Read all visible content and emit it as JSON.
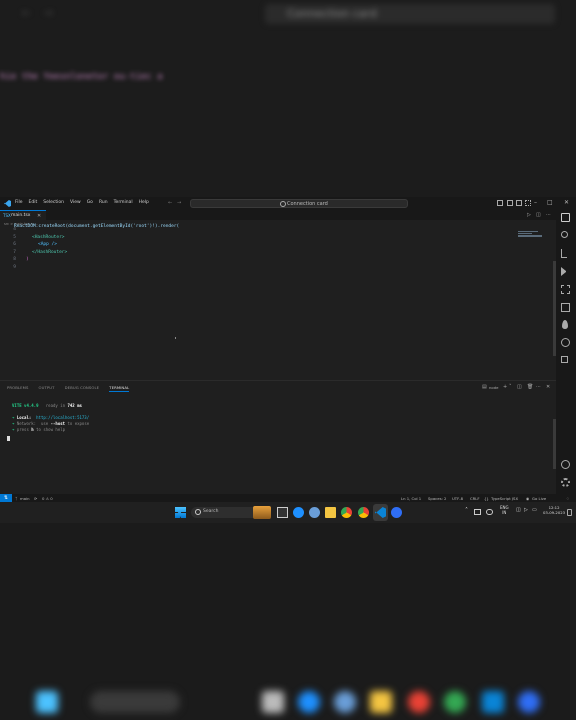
{
  "background": {
    "window_title": "Connection card",
    "code_line": "hie the Yeesnlonetor ou-tiec a"
  },
  "titlebar": {
    "menu": [
      "File",
      "Edit",
      "Selection",
      "View",
      "Go",
      "Run",
      "Terminal",
      "Help"
    ],
    "command_center": "Connection card"
  },
  "editor": {
    "tab_icon": "TSX",
    "tab_label": "main.tsx",
    "breadcrumb": "src > main.tsx > ...",
    "lines": [
      {
        "num": "4",
        "text": "ReactDOM.createRoot(document.getElementById('root')!).render("
      },
      {
        "num": "5",
        "text": "<HashRouter>"
      },
      {
        "num": "6",
        "text": "<App />"
      },
      {
        "num": "7",
        "text": "</HashRouter>"
      },
      {
        "num": "8",
        "text": ")"
      },
      {
        "num": "9",
        "text": ""
      }
    ]
  },
  "panel": {
    "tabs": [
      "PROBLEMS",
      "OUTPUT",
      "DEBUG CONSOLE",
      "TERMINAL"
    ],
    "terminal_label": "node",
    "terminal": {
      "vite": "VITE v4.4.9",
      "ready": "ready in",
      "ready_ms": "742 ms",
      "local_label": "Local:",
      "local_url": "http://localhost:5173/",
      "network_label": "Network:",
      "network_hint_pre": "use",
      "network_hint_flag": "--host",
      "network_hint_post": "to expose",
      "help_pre": "press",
      "help_key": "h",
      "help_post": "to show help"
    }
  },
  "statusbar": {
    "branch": "main",
    "problems": "0 ⚠ 0",
    "cursor": "Ln 1, Col 1",
    "spaces": "Spaces: 2",
    "encoding": "UTF-8",
    "eol": "CRLF",
    "language": "TypeScript JSX",
    "golive": "Go Live"
  },
  "taskbar": {
    "search_label": "Search",
    "lang_top": "ENG",
    "lang_bottom": "IN",
    "time": "12:12",
    "date": "03-09-2023"
  },
  "colors": {
    "accent": "#0078d4",
    "editor_bg": "#1f1f1f",
    "tag": "#4ec9b0",
    "component": "#4fc1ff",
    "terminal_green": "#23d18b",
    "terminal_cyan": "#29b8db"
  }
}
